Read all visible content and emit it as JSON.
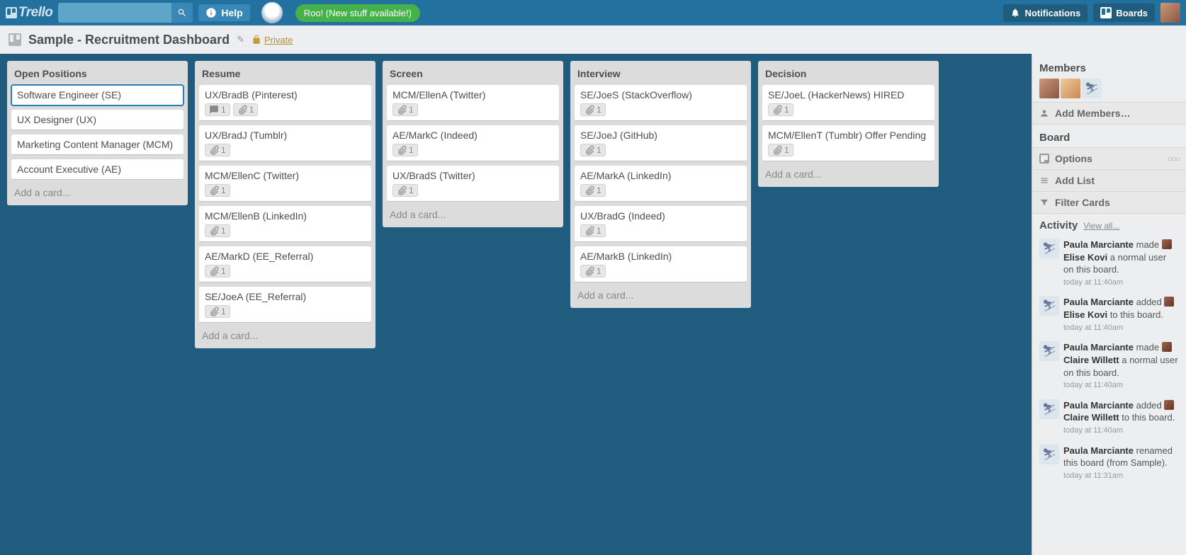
{
  "topbar": {
    "logo": "Trello",
    "help": "Help",
    "roo": "Roo! (New stuff available!)",
    "notifications": "Notifications",
    "boards": "Boards"
  },
  "board": {
    "title": "Sample - Recruitment Dashboard",
    "privacy": "Private"
  },
  "lists": [
    {
      "title": "Open Positions",
      "cards": [
        {
          "name": "Software Engineer (SE)",
          "selected": true
        },
        {
          "name": "UX Designer (UX)"
        },
        {
          "name": "Marketing Content Manager (MCM)"
        },
        {
          "name": "Account Executive (AE)"
        }
      ]
    },
    {
      "title": "Resume",
      "cards": [
        {
          "name": "UX/BradB (Pinterest)",
          "comments": 1,
          "attachments": 1
        },
        {
          "name": "UX/BradJ (Tumblr)",
          "attachments": 1
        },
        {
          "name": "MCM/EllenC (Twitter)",
          "attachments": 1
        },
        {
          "name": "MCM/EllenB (LinkedIn)",
          "attachments": 1
        },
        {
          "name": "AE/MarkD (EE_Referral)",
          "attachments": 1
        },
        {
          "name": "SE/JoeA (EE_Referral)",
          "attachments": 1
        }
      ]
    },
    {
      "title": "Screen",
      "cards": [
        {
          "name": "MCM/EllenA (Twitter)",
          "attachments": 1
        },
        {
          "name": "AE/MarkC (Indeed)",
          "attachments": 1
        },
        {
          "name": "UX/BradS (Twitter)",
          "attachments": 1
        }
      ]
    },
    {
      "title": "Interview",
      "cards": [
        {
          "name": "SE/JoeS (StackOverflow)",
          "attachments": 1
        },
        {
          "name": "SE/JoeJ (GitHub)",
          "attachments": 1
        },
        {
          "name": "AE/MarkA (LinkedIn)",
          "attachments": 1
        },
        {
          "name": "UX/BradG (Indeed)",
          "attachments": 1
        },
        {
          "name": "AE/MarkB (LinkedIn)",
          "attachments": 1
        }
      ]
    },
    {
      "title": "Decision",
      "cards": [
        {
          "name": "SE/JoeL (HackerNews) HIRED",
          "attachments": 1
        },
        {
          "name": "MCM/EllenT (Tumblr) Offer Pending",
          "attachments": 1
        }
      ]
    }
  ],
  "add_card": "Add a card...",
  "sidebar": {
    "members_heading": "Members",
    "add_members": "Add Members…",
    "board_heading": "Board",
    "options": "Options",
    "add_list": "Add List",
    "filter_cards": "Filter Cards",
    "activity_heading": "Activity",
    "view_all": "View all...",
    "activity": [
      {
        "actor": "Paula Marciante",
        "rest1": " made ",
        "target": "Elise Kovi",
        "rest2": " a normal user on this board.",
        "time": "today at 11:40am",
        "mini": true
      },
      {
        "actor": "Paula Marciante",
        "rest1": " added ",
        "target": "Elise Kovi",
        "rest2": " to this board.",
        "time": "today at 11:40am",
        "mini": true
      },
      {
        "actor": "Paula Marciante",
        "rest1": " made ",
        "target": "Claire Willett",
        "rest2": " a normal user on this board.",
        "time": "today at 11:40am",
        "mini": true
      },
      {
        "actor": "Paula Marciante",
        "rest1": " added ",
        "target": "Claire Willett",
        "rest2": " to this board.",
        "time": "today at 11:40am",
        "mini": true
      },
      {
        "actor": "Paula Marciante",
        "rest1": " renamed this board (from Sample).",
        "target": "",
        "rest2": "",
        "time": "today at 11:31am",
        "mini": false
      }
    ]
  }
}
